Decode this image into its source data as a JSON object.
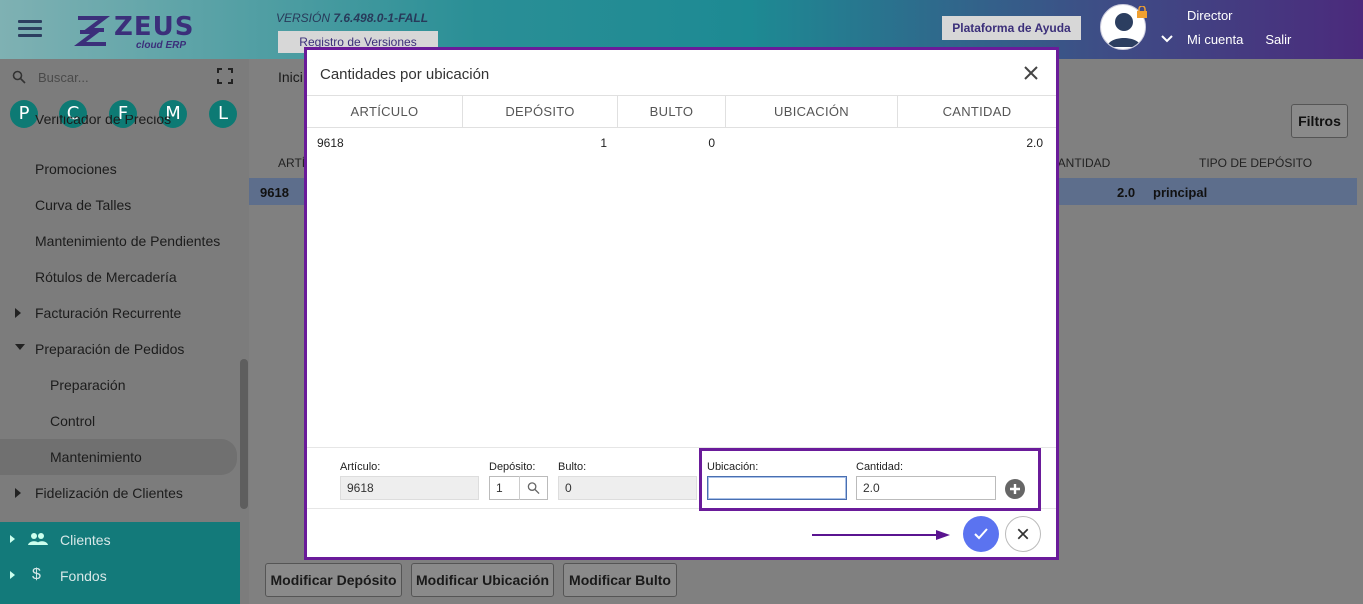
{
  "header": {
    "logo_text": "ZEUS",
    "logo_sub": "cloud ERP",
    "version_prefix": "VERSIÓN",
    "version_number": "7.6.498.0-1-FALL",
    "changelog_button": "Registro de Versiones",
    "help_button": "Plataforma de Ayuda",
    "user_role": "Director",
    "my_account": "Mi cuenta",
    "logout": "Salir"
  },
  "sidebar": {
    "search_placeholder": "Buscar...",
    "shortcuts": [
      "P",
      "C",
      "F",
      "M",
      "L"
    ],
    "items": [
      {
        "label": "Verificador de Precios"
      },
      {
        "label": "Promociones"
      },
      {
        "label": "Curva de Talles"
      },
      {
        "label": "Mantenimiento de Pendientes"
      },
      {
        "label": "Rótulos de Mercadería"
      },
      {
        "label": "Facturación Recurrente"
      },
      {
        "label": "Preparación de Pedidos"
      },
      {
        "label": "Preparación"
      },
      {
        "label": "Control"
      },
      {
        "label": "Mantenimiento"
      },
      {
        "label": "Fidelización de Clientes"
      }
    ],
    "modules": [
      {
        "label": "Clientes",
        "icon": "people-icon"
      },
      {
        "label": "Fondos",
        "icon": "dollar-icon"
      }
    ]
  },
  "background": {
    "breadcrumb_tab": "Inici",
    "filters_button": "Filtros",
    "headers": {
      "articulo": "ARTÍ",
      "cantidad": "CANTIDAD",
      "tipo_deposito": "TIPO DE DEPÓSITO"
    },
    "row": {
      "articulo": "9618",
      "cantidad": "2.0",
      "tipo_deposito": "principal"
    },
    "buttons": {
      "modify_deposit": "Modificar Depósito",
      "modify_location": "Modificar Ubicación",
      "modify_package": "Modificar Bulto"
    }
  },
  "modal": {
    "title": "Cantidades por ubicación",
    "columns": [
      "ARTÍCULO",
      "DEPÓSITO",
      "BULTO",
      "UBICACIÓN",
      "CANTIDAD"
    ],
    "rows": [
      {
        "articulo": "9618",
        "deposito": "1",
        "bulto": "0",
        "ubicacion": "",
        "cantidad": "2.0"
      }
    ],
    "form": {
      "articulo_label": "Artículo:",
      "articulo_value": "9618",
      "deposito_label": "Depósito:",
      "deposito_value": "1",
      "bulto_label": "Bulto:",
      "bulto_value": "0",
      "ubicacion_label": "Ubicación:",
      "ubicacion_value": "",
      "cantidad_label": "Cantidad:",
      "cantidad_value": "2.0"
    }
  },
  "colors": {
    "accent_purple": "#6a1b9a",
    "confirm_blue": "#5b73f0",
    "teal": "#137a7a"
  }
}
